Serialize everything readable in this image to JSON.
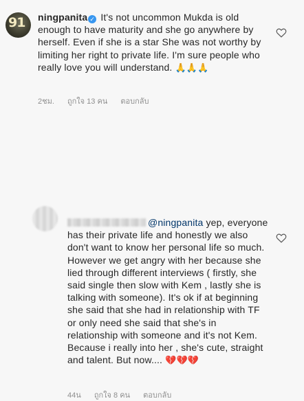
{
  "comments": [
    {
      "username": "ningpanita",
      "text": "It's not uncommon Mukda is old enough to have maturity and she go anywhere by herself. Even if she is a star She was not worthy by limiting her right to private life. I'm sure people who really love you will understand.",
      "emojis": "🙏🙏🙏",
      "time": "2ชม.",
      "likes": "ถูกใจ 13 คน",
      "reply": "ตอบกลับ"
    },
    {
      "mention": "@ningpanita",
      "text": "yep, everyone has their private life and honestly we also don't want to know her personal life so much. However we get angry with her because she lied through different interviews ( firstly, she said single then slow with Kem , lastly she is talking with someone). It's ok if at beginning she said that she had in relationship with TF or only need she said that she's in relationship with someone and it's not Kem. Because i really into her , she's  cute, straight and talent. But now....",
      "emojis": "💔💔💔",
      "time": "44น",
      "likes": "ถูกใจ 8 คน",
      "reply": "ตอบกลับ"
    }
  ],
  "colors": {
    "text": "#262626",
    "meta": "#8e8e8e",
    "mention": "#003569",
    "verified": "#3897f0"
  },
  "icons": {
    "verified": "verified-badge-icon",
    "like": "heart-outline-icon"
  }
}
